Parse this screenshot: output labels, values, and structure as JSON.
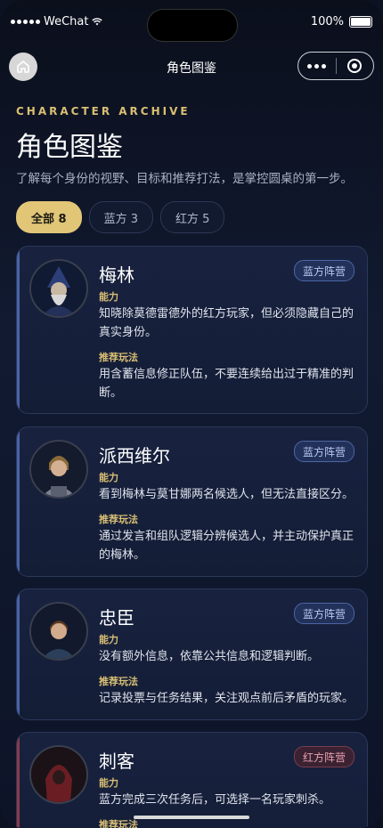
{
  "status_bar": {
    "carrier": "WeChat",
    "battery": "100%"
  },
  "nav": {
    "title": "角色图鉴"
  },
  "header": {
    "eyebrow": "CHARACTER ARCHIVE",
    "title": "角色图鉴",
    "subtitle": "了解每个身份的视野、目标和推荐打法，是掌控圆桌的第一步。"
  },
  "filters": [
    {
      "label": "全部 8",
      "active": true
    },
    {
      "label": "蓝方 3",
      "active": false
    },
    {
      "label": "红方 5",
      "active": false
    }
  ],
  "labels": {
    "ability": "能力",
    "strategy": "推荐玩法"
  },
  "characters": [
    {
      "name": "梅林",
      "faction": "蓝方阵营",
      "ability": "知晓除莫德雷德外的红方玩家，但必须隐藏自己的真实身份。",
      "strategy": "用含蓄信息修正队伍，不要连续给出过于精准的判断。"
    },
    {
      "name": "派西维尔",
      "faction": "蓝方阵营",
      "ability": "看到梅林与莫甘娜两名候选人，但无法直接区分。",
      "strategy": "通过发言和组队逻辑分辨候选人，并主动保护真正的梅林。"
    },
    {
      "name": "忠臣",
      "faction": "蓝方阵营",
      "ability": "没有额外信息，依靠公共信息和逻辑判断。",
      "strategy": "记录投票与任务结果，关注观点前后矛盾的玩家。"
    },
    {
      "name": "刺客",
      "faction": "红方阵营",
      "ability": "蓝方完成三次任务后，可选择一名玩家刺杀。",
      "strategy": ""
    }
  ],
  "colors": {
    "accent": "#d9bf74",
    "blue_border": "#4a63a8",
    "red_border": "#8a3a48",
    "background": "#0c1222"
  },
  "icons": [
    "home-icon",
    "more-icon",
    "target-icon",
    "wifi-icon",
    "battery-icon"
  ]
}
